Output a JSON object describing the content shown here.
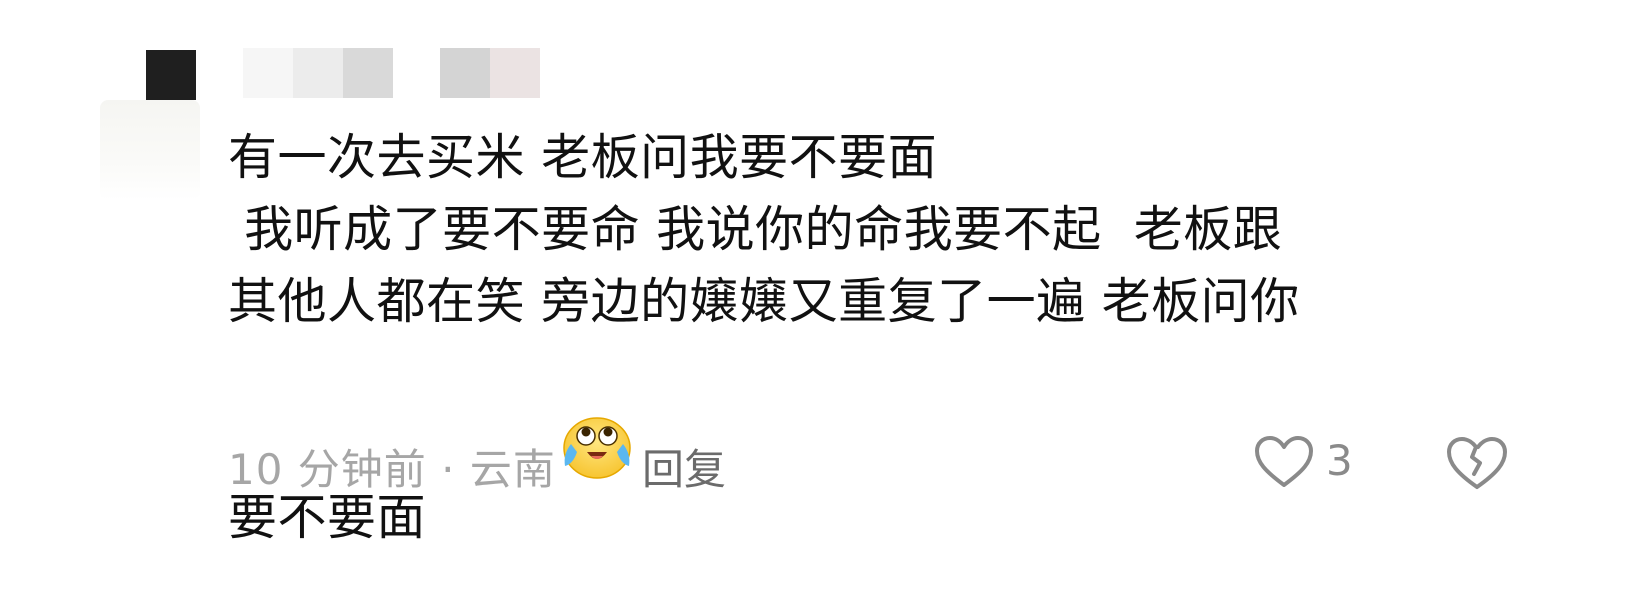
{
  "comment": {
    "text_lines": [
      "有一次去买米 老板问我要不要面",
      " 我听成了要不要命 我说你的命我要不起  老板跟",
      "其他人都在笑 旁边的嬢嬢又重复了一遍 老板问你",
      "要不要面"
    ],
    "emoji": "crying-laughing-face-icon",
    "meta": "10 分钟前 · 云南",
    "reply_label": "回复",
    "like_count": "3",
    "icons": {
      "like": "heart-outline-icon",
      "dislike": "broken-heart-icon"
    },
    "colors": {
      "text": "#111111",
      "meta": "#a6a6a6",
      "reply": "#6b6b6b",
      "icon": "#8a8a8a"
    }
  }
}
